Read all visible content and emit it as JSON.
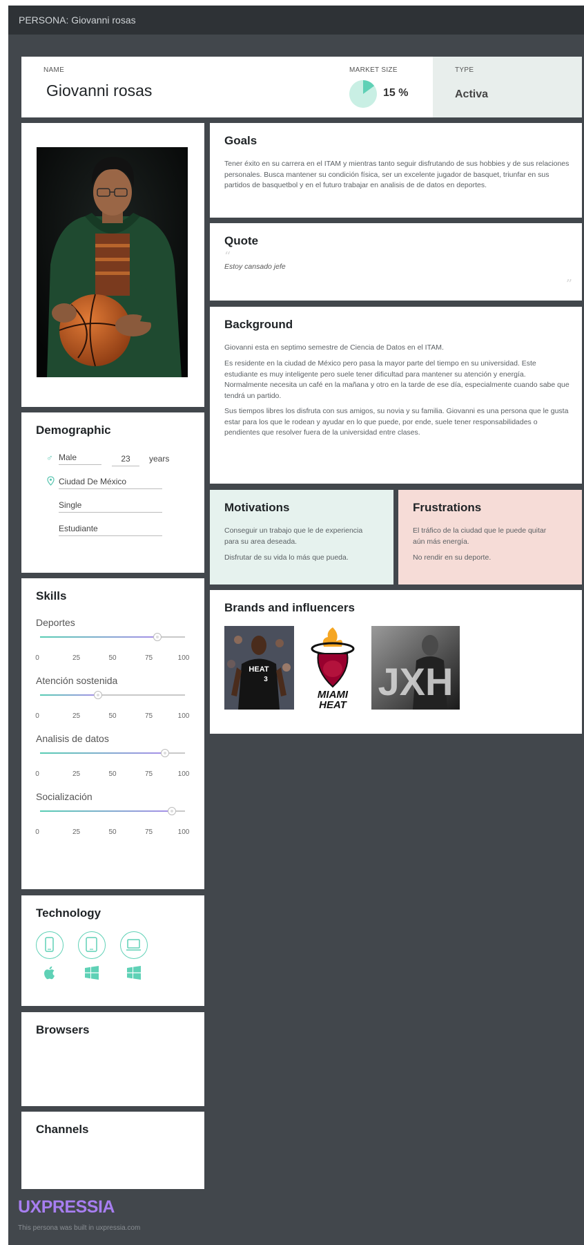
{
  "topbar": {
    "title": "PERSONA: Giovanni rosas"
  },
  "header": {
    "name_label": "NAME",
    "name": "Giovanni rosas",
    "market_size_label": "MARKET SIZE",
    "market_size_value": "15 %",
    "market_size_fraction": 0.15,
    "type_label": "TYPE",
    "type_value": "Activa"
  },
  "demographic": {
    "title": "Demographic",
    "gender": "Male",
    "age": "23",
    "age_unit": "years",
    "location": "Ciudad De México",
    "status": "Single",
    "occupation": "Estudiante"
  },
  "skills": {
    "title": "Skills",
    "ticks": [
      "0",
      "25",
      "50",
      "75",
      "100"
    ],
    "items": [
      {
        "name": "Deportes",
        "value": 81
      },
      {
        "name": "Atención sostenida",
        "value": 40
      },
      {
        "name": "Analisis de datos",
        "value": 86
      },
      {
        "name": "Socialización",
        "value": 91
      }
    ]
  },
  "technology": {
    "title": "Technology",
    "devices": [
      "phone-icon",
      "tablet-icon",
      "laptop-icon"
    ],
    "os": [
      "apple-icon",
      "windows-icon",
      "windows-icon"
    ]
  },
  "browsers": {
    "title": "Browsers"
  },
  "channels": {
    "title": "Channels"
  },
  "goals": {
    "title": "Goals",
    "text": "Tener éxito en su carrera en el ITAM y mientras tanto seguir disfrutando de sus hobbies y de sus relaciones personales. Busca mantener su condición física, ser un excelente jugador de basquet, triunfar en sus partidos de basquetbol y en el futuro trabajar en analisis de de datos en deportes."
  },
  "quote": {
    "title": "Quote",
    "text": "Estoy cansado jefe"
  },
  "background": {
    "title": "Background",
    "paragraphs": [
      "Giovanni esta en septimo semestre de Ciencia de Datos en el ITAM.",
      "Es residente en la ciudad de México pero pasa la mayor parte del tiempo en su universidad. Este estudiante es muy inteligente pero suele tener dificultad para mantener su atención y energía. Normalmente necesita un café en la mañana y otro en la tarde de ese día, especialmente cuando sabe que tendrá un partido.",
      "Sus tiempos libres los disfruta con sus amigos, su novia y su familia. Giovanni es una persona que le gusta estar para los que le rodean y ayudar en lo que puede, por ende, suele tener responsabilidades o pendientes que resolver fuera de la universidad entre clases."
    ]
  },
  "motivations": {
    "title": "Motivations",
    "items": [
      "Conseguir un trabajo que le de experiencia para su area deseada.",
      "Disfrutar de su vida lo más que pueda."
    ]
  },
  "frustrations": {
    "title": "Frustrations",
    "items": [
      "El tráfico de la ciudad que le puede quitar aún más energía.",
      "No rendir en su deporte."
    ]
  },
  "brands": {
    "title": "Brands and influencers",
    "jersey_text": "HEAT",
    "jersey_number": "3",
    "logo_line1": "MIAMI",
    "logo_line2": "HEAT",
    "third_image_text": "JXH"
  },
  "footer": {
    "logo": "UXPRESSIA",
    "note": "This persona was built in uxpressia.com"
  },
  "colors": {
    "accent_teal": "#5fd1b6",
    "accent_purple": "#a78ee8",
    "motivations_bg": "#e6f2ee",
    "frustrations_bg": "#f6dcd7",
    "frame_bg": "#42474c"
  }
}
